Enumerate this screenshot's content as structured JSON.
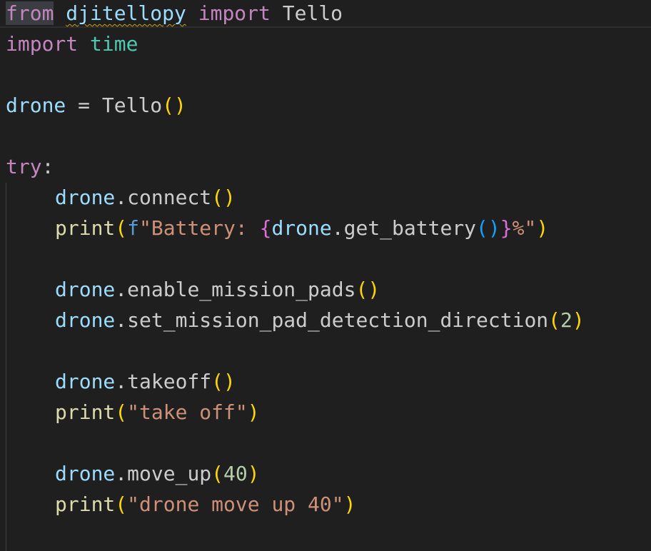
{
  "lines": [
    {
      "tokens": {
        "from": "from",
        "module": "djitellopy",
        "import": "import",
        "name": "Tello"
      }
    },
    {
      "tokens": {
        "import": "import",
        "module": "time"
      }
    },
    {
      "tokens": {
        "var": "drone",
        "eq": " = ",
        "call": "Tello",
        "paren_open": "(",
        "paren_close": ")"
      }
    },
    {
      "tokens": {
        "kw": "try",
        "colon": ":"
      }
    },
    {
      "tokens": {
        "obj": "drone",
        "dot": ".",
        "method": "connect",
        "paren_open": "(",
        "paren_close": ")"
      }
    },
    {
      "tokens": {
        "fn": "print",
        "paren_open": "(",
        "fprefix": "f",
        "str_start": "\"Battery: ",
        "brace_open": "{",
        "obj": "drone",
        "dot": ".",
        "method": "get_battery",
        "inner_open": "(",
        "inner_close": ")",
        "brace_close": "}",
        "str_end": "%\"",
        "paren_close": ")"
      }
    },
    {
      "tokens": {
        "obj": "drone",
        "dot": ".",
        "method": "enable_mission_pads",
        "paren_open": "(",
        "paren_close": ")"
      }
    },
    {
      "tokens": {
        "obj": "drone",
        "dot": ".",
        "method": "set_mission_pad_detection_direction",
        "paren_open": "(",
        "arg": "2",
        "paren_close": ")"
      }
    },
    {
      "tokens": {
        "obj": "drone",
        "dot": ".",
        "method": "takeoff",
        "paren_open": "(",
        "paren_close": ")"
      }
    },
    {
      "tokens": {
        "fn": "print",
        "paren_open": "(",
        "str": "\"take off\"",
        "paren_close": ")"
      }
    },
    {
      "tokens": {
        "obj": "drone",
        "dot": ".",
        "method": "move_up",
        "paren_open": "(",
        "arg": "40",
        "paren_close": ")"
      }
    },
    {
      "tokens": {
        "fn": "print",
        "paren_open": "(",
        "str": "\"drone move up 40\"",
        "paren_close": ")"
      }
    }
  ],
  "colors": {
    "background": "#1f1f1f",
    "keyword": "#c586c0",
    "variable": "#9cdcfe",
    "module": "#4ec9b0",
    "function": "#dcdcaa",
    "string": "#ce9178",
    "number": "#b5cea8",
    "bracket_level1": "#ffd700",
    "bracket_level2": "#da70d6",
    "bracket_level3": "#179fff",
    "warning_squiggle": "#cca700"
  }
}
